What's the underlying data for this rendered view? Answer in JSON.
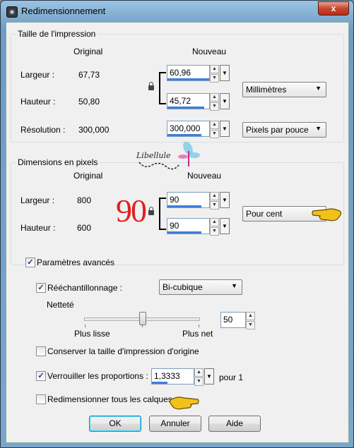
{
  "window": {
    "title": "Redimensionnement",
    "close": "x"
  },
  "print_size": {
    "legend": "Taille de l'impression",
    "col_original": "Original",
    "col_new": "Nouveau",
    "width_label": "Largeur :",
    "width_original": "67,73",
    "width_new": "60,96",
    "height_label": "Hauteur :",
    "height_original": "50,80",
    "height_new": "45,72",
    "resolution_label": "Résolution :",
    "resolution_original": "300,000",
    "resolution_new": "300,000",
    "unit_select": "Millimètres",
    "resolution_unit_select": "Pixels par pouce"
  },
  "pixel_dims": {
    "legend": "Dimensions en pixels",
    "col_original": "Original",
    "col_new": "Nouveau",
    "width_label": "Largeur :",
    "width_original": "800",
    "width_new": "90",
    "height_label": "Hauteur :",
    "height_original": "600",
    "height_new": "90",
    "unit_select": "Pour cent",
    "annotation_number": "90",
    "logo_text": "Libellule"
  },
  "advanced": {
    "checkbox_label": "Paramètres avancés",
    "checked": true,
    "resample_label": "Rééchantillonnage :",
    "resample_checked": true,
    "resample_method": "Bi-cubique",
    "sharpness_label": "Netteté",
    "sharpness_min_label": "Plus lisse",
    "sharpness_max_label": "Plus net",
    "sharpness_value": "50",
    "keep_print_size_label": "Conserver la taille d'impression d'origine",
    "keep_print_size_checked": false,
    "lock_ratio_label": "Verrouiller les proportions :",
    "lock_ratio_checked": true,
    "ratio_value": "1,3333",
    "ratio_suffix": "pour 1",
    "resize_all_layers_label": "Redimensionner tous les calques",
    "resize_all_layers_checked": false
  },
  "buttons": {
    "ok": "OK",
    "cancel": "Annuler",
    "help": "Aide"
  },
  "colors": {
    "accent": "#3c7fd8",
    "annotation_red": "#e02020",
    "hand_yellow": "#f2c21a"
  }
}
